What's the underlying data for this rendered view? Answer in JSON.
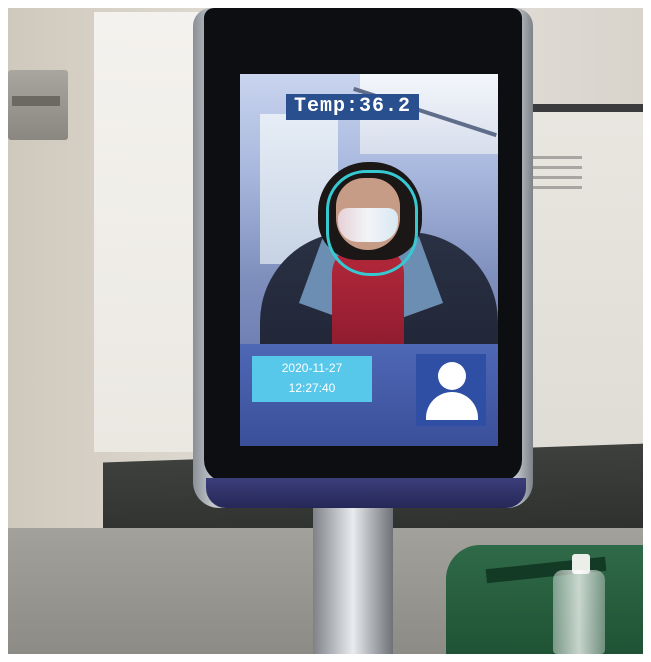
{
  "screen": {
    "temperature_label": "Temp:36.2",
    "date": "2020-11-27",
    "time": "12:27:40",
    "avatar_icon": "person-silhouette-icon",
    "footer_text": ""
  },
  "colors": {
    "screen_status_bar": "#4e68b6",
    "datetime_box": "#57c7ea",
    "face_box": "#36c9d1",
    "temp_label_bg": "#2a4f8f"
  }
}
